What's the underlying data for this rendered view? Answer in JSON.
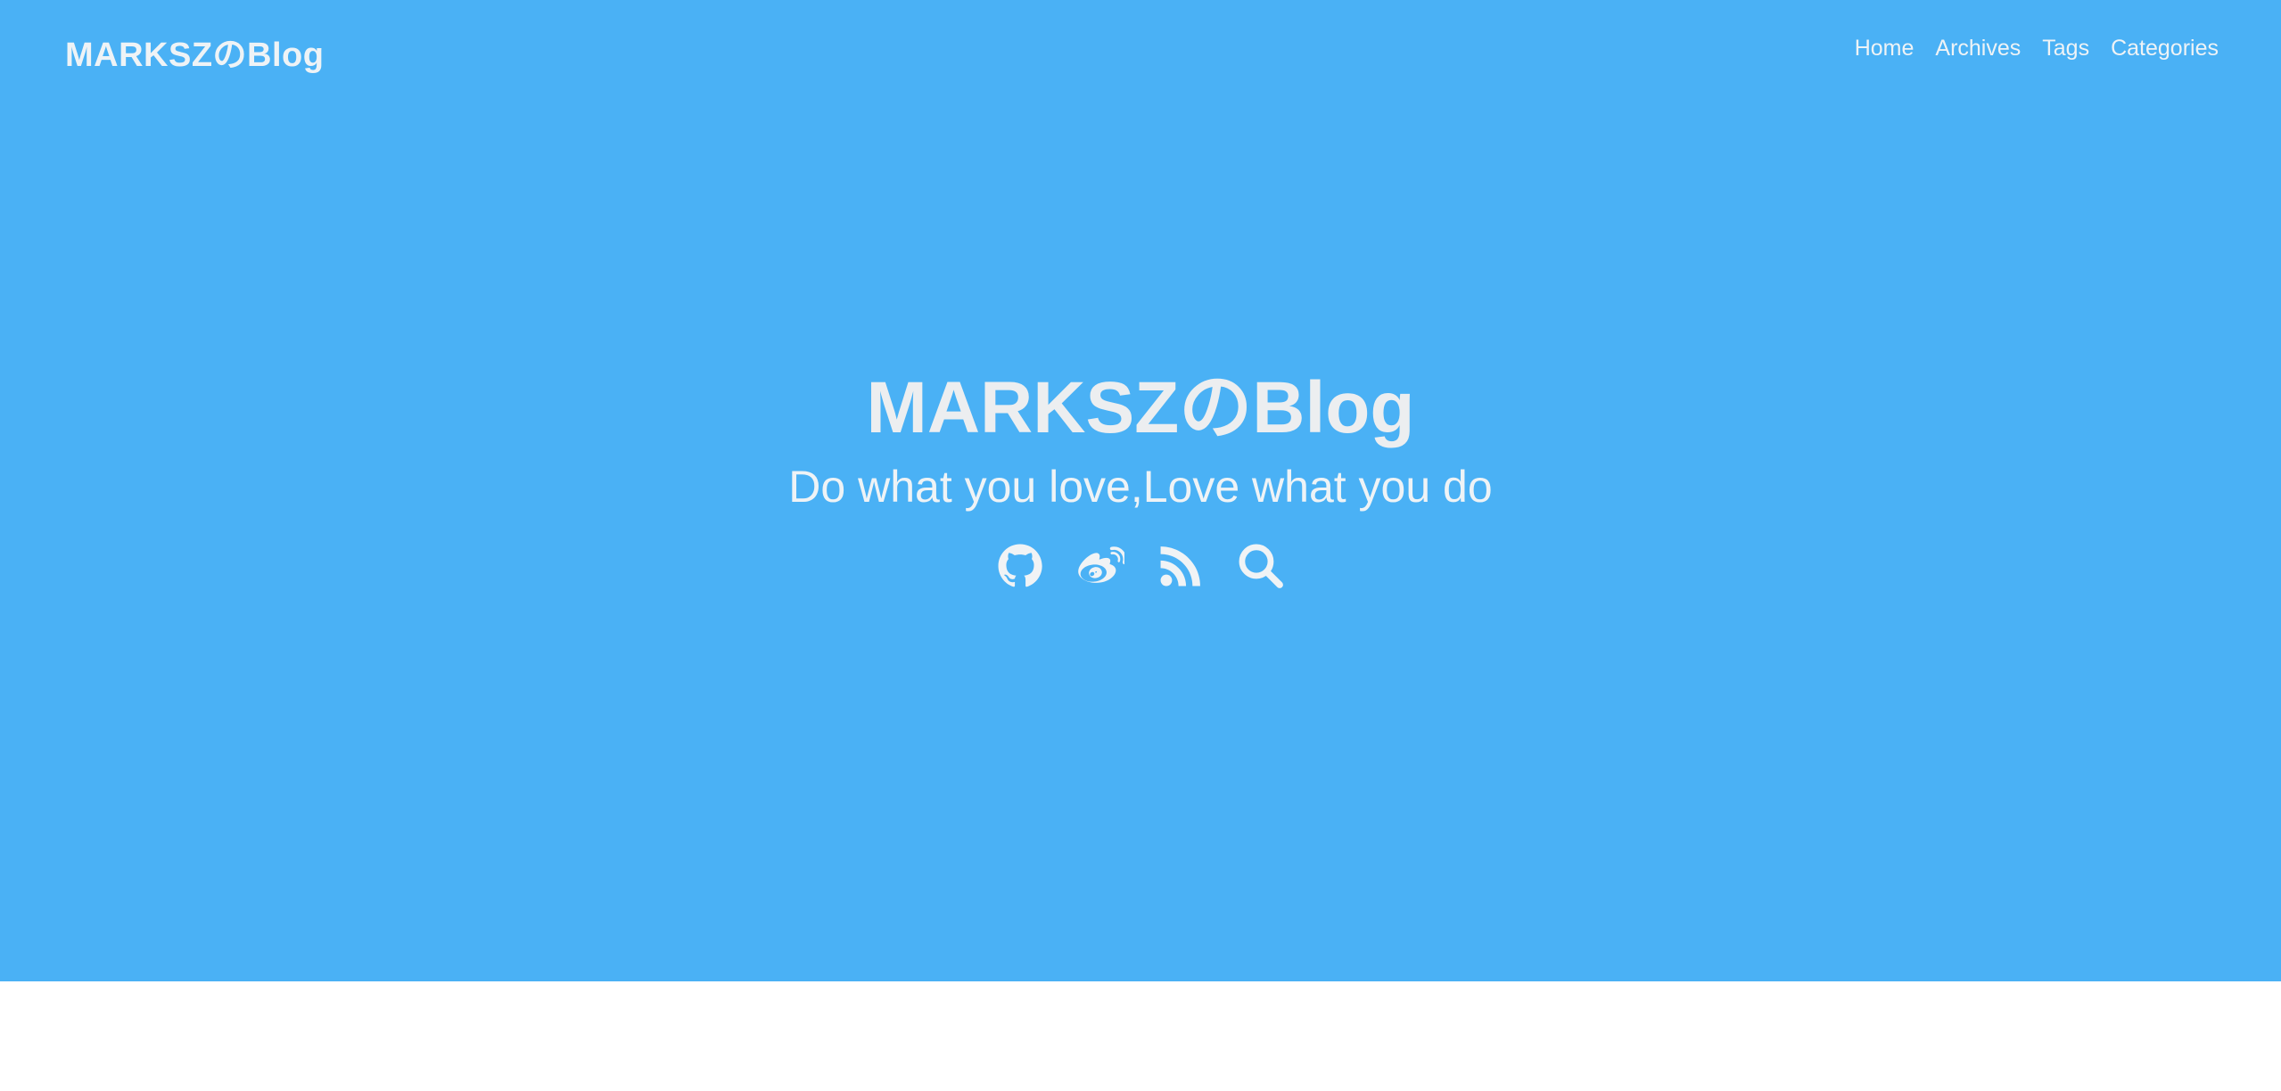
{
  "site": {
    "brand": "MARKSZのBlog"
  },
  "nav": {
    "items": [
      {
        "label": "Home"
      },
      {
        "label": "Archives"
      },
      {
        "label": "Tags"
      },
      {
        "label": "Categories"
      }
    ]
  },
  "hero": {
    "title": "MARKSZのBlog",
    "subtitle": "Do what you love,Love what you do",
    "icons": [
      "github-icon",
      "weibo-icon",
      "rss-icon",
      "search-icon"
    ]
  },
  "colors": {
    "hero_background": "#4ab1f5",
    "text": "#eef3f6",
    "page_background": "#ffffff"
  }
}
